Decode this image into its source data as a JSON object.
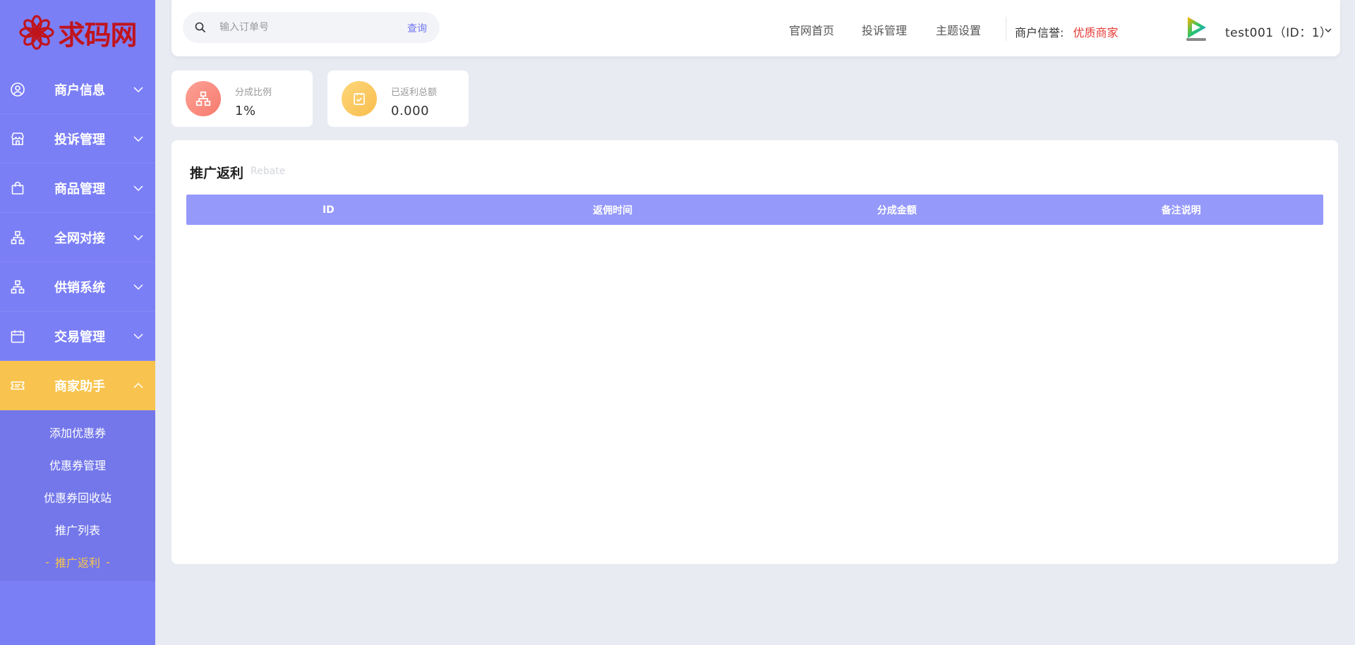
{
  "brand": {
    "logo_text": "求码网"
  },
  "sidebar": {
    "items": [
      {
        "label": "商户信息",
        "icon": "user-circle-icon",
        "expanded": false
      },
      {
        "label": "投诉管理",
        "icon": "store-icon",
        "expanded": false
      },
      {
        "label": "商品管理",
        "icon": "shopping-bag-icon",
        "expanded": false
      },
      {
        "label": "全网对接",
        "icon": "sitemap-icon",
        "expanded": false
      },
      {
        "label": "供销系统",
        "icon": "sitemap-icon",
        "expanded": false
      },
      {
        "label": "交易管理",
        "icon": "calendar-icon",
        "expanded": false
      },
      {
        "label": "商家助手",
        "icon": "ticket-icon",
        "expanded": true
      }
    ],
    "submenu": [
      {
        "label": "添加优惠券"
      },
      {
        "label": "优惠券管理"
      },
      {
        "label": "优惠券回收站"
      },
      {
        "label": "推广列表"
      },
      {
        "label": "推广返利",
        "current": true
      }
    ],
    "current_dash": "-"
  },
  "header": {
    "search_placeholder": "输入订单号",
    "search_button": "查询",
    "nav": [
      "官网首页",
      "投诉管理",
      "主题设置"
    ],
    "credit_label": "商户信誉:",
    "credit_value": "优质商家",
    "user_display": "test001（ID：1）"
  },
  "stats": [
    {
      "label": "分成比例",
      "value": "1%",
      "icon": "sitemap-icon",
      "color": "#fb8a7d"
    },
    {
      "label": "已返利总额",
      "value": "0.000",
      "icon": "clipboard-check-icon",
      "color": "#fbc75a"
    }
  ],
  "panel": {
    "title": "推广返利",
    "subtitle": "Rebate",
    "columns": [
      "ID",
      "返佣时间",
      "分成金额",
      "备注说明"
    ],
    "rows": []
  },
  "colors": {
    "sidebar_bg": "#7b7ff6",
    "active_bg": "#f8c44f",
    "table_header": "#9599fa",
    "credit_red": "#e53935"
  }
}
